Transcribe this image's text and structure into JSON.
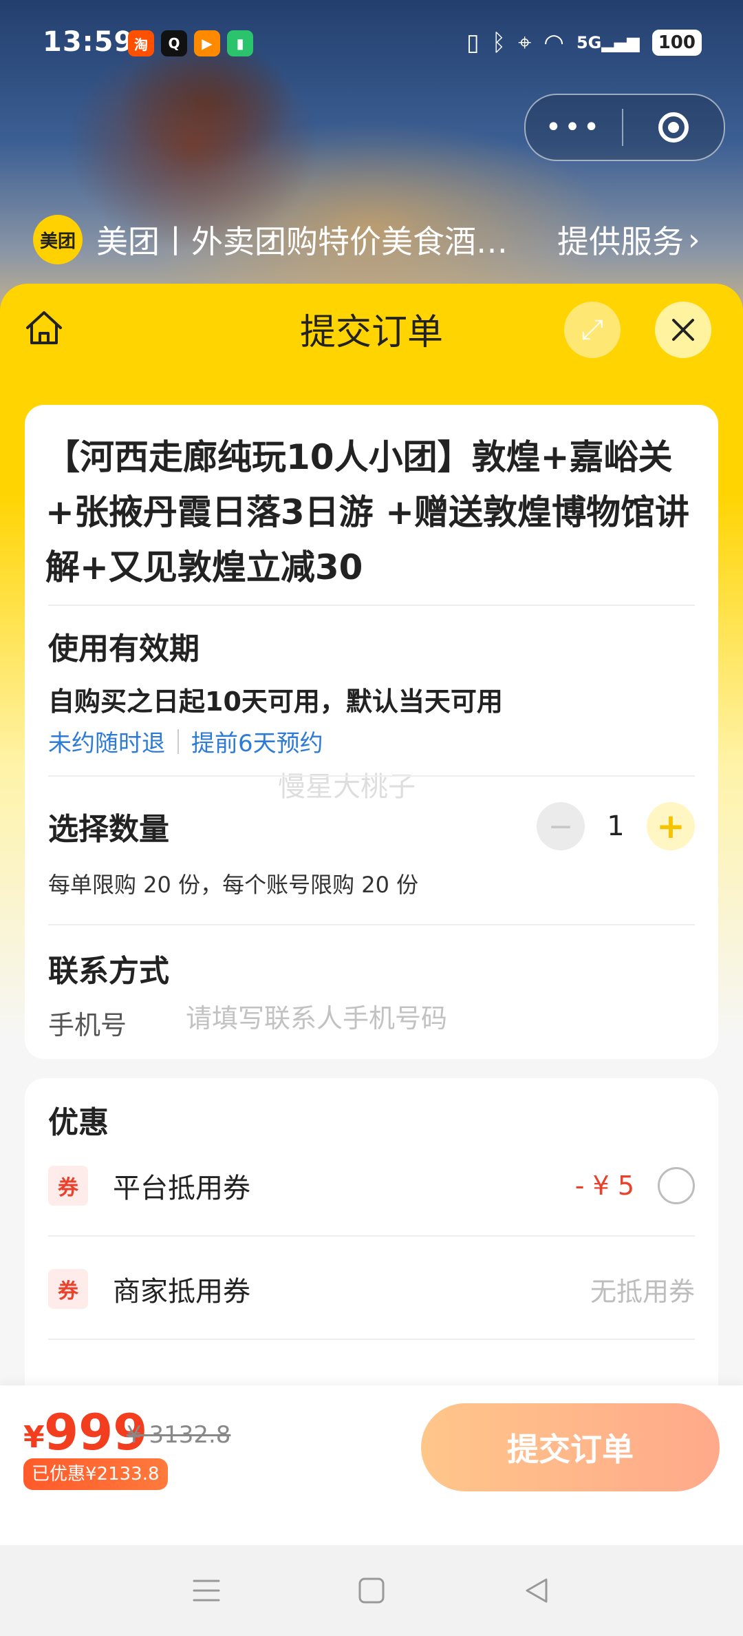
{
  "status_bar": {
    "time": "13:59",
    "battery": "100",
    "network": "5G",
    "apps": [
      {
        "name": "taobao-app-icon",
        "glyph": "淘",
        "color": "#ff5000"
      },
      {
        "name": "qq-app-icon",
        "glyph": "Q",
        "color": "#111111"
      },
      {
        "name": "video-app-icon",
        "glyph": "▶",
        "color": "#ff8a00"
      },
      {
        "name": "battery-app-icon",
        "glyph": "▮",
        "color": "#2bc36b"
      }
    ]
  },
  "capsule": {
    "more_icon": "more-dots-icon",
    "more_glyph": "•••",
    "close_icon": "target-close-icon"
  },
  "service": {
    "logo_text": "美团",
    "name": "美团丨外卖团购特价美食酒店...",
    "link": "提供服务",
    "chevron": "›"
  },
  "panel": {
    "title": "提交订单",
    "home_icon": "home-icon",
    "expand_icon": "expand-icon",
    "expand_glyph": "⤢",
    "close_icon": "close-icon"
  },
  "product": {
    "title": "【河西走廊纯玩10人小团】敦煌+嘉峪关+张掖丹霞日落3日游 +赠送敦煌博物馆讲解+又见敦煌立减30"
  },
  "validity": {
    "title": "使用有效期",
    "text": "自购买之日起10天可用，默认当天可用",
    "tags": [
      "未约随时退",
      "提前6天预约"
    ]
  },
  "watermark": "慢星大桃子",
  "quantity": {
    "title": "选择数量",
    "minus": "−",
    "value": "1",
    "plus": "+",
    "limit": "每单限购 20 份，每个账号限购 20 份"
  },
  "contact": {
    "title": "联系方式",
    "phone_label": "手机号",
    "phone_placeholder": "请填写联系人手机号码",
    "phone_value": ""
  },
  "discount": {
    "title": "优惠",
    "rows": [
      {
        "icon": "券",
        "label": "平台抵用券",
        "amount": "- ¥ 5"
      },
      {
        "icon": "券",
        "label": "商家抵用券",
        "status": "无抵用券"
      }
    ]
  },
  "bottom": {
    "currency": "¥",
    "price": "999",
    "original": "¥ 3132.8",
    "saved": "已优惠¥2133.8",
    "submit": "提交订单"
  },
  "colors": {
    "brand_yellow": "#ffd400",
    "price_red": "#f23d1f",
    "link_blue": "#2d7bd6",
    "submit_gradient": [
      "#ffc68a",
      "#ffa98a"
    ]
  },
  "navbar": {
    "menu_icon": "menu-icon",
    "home_icon": "square-home-icon",
    "back_icon": "back-triangle-icon"
  }
}
